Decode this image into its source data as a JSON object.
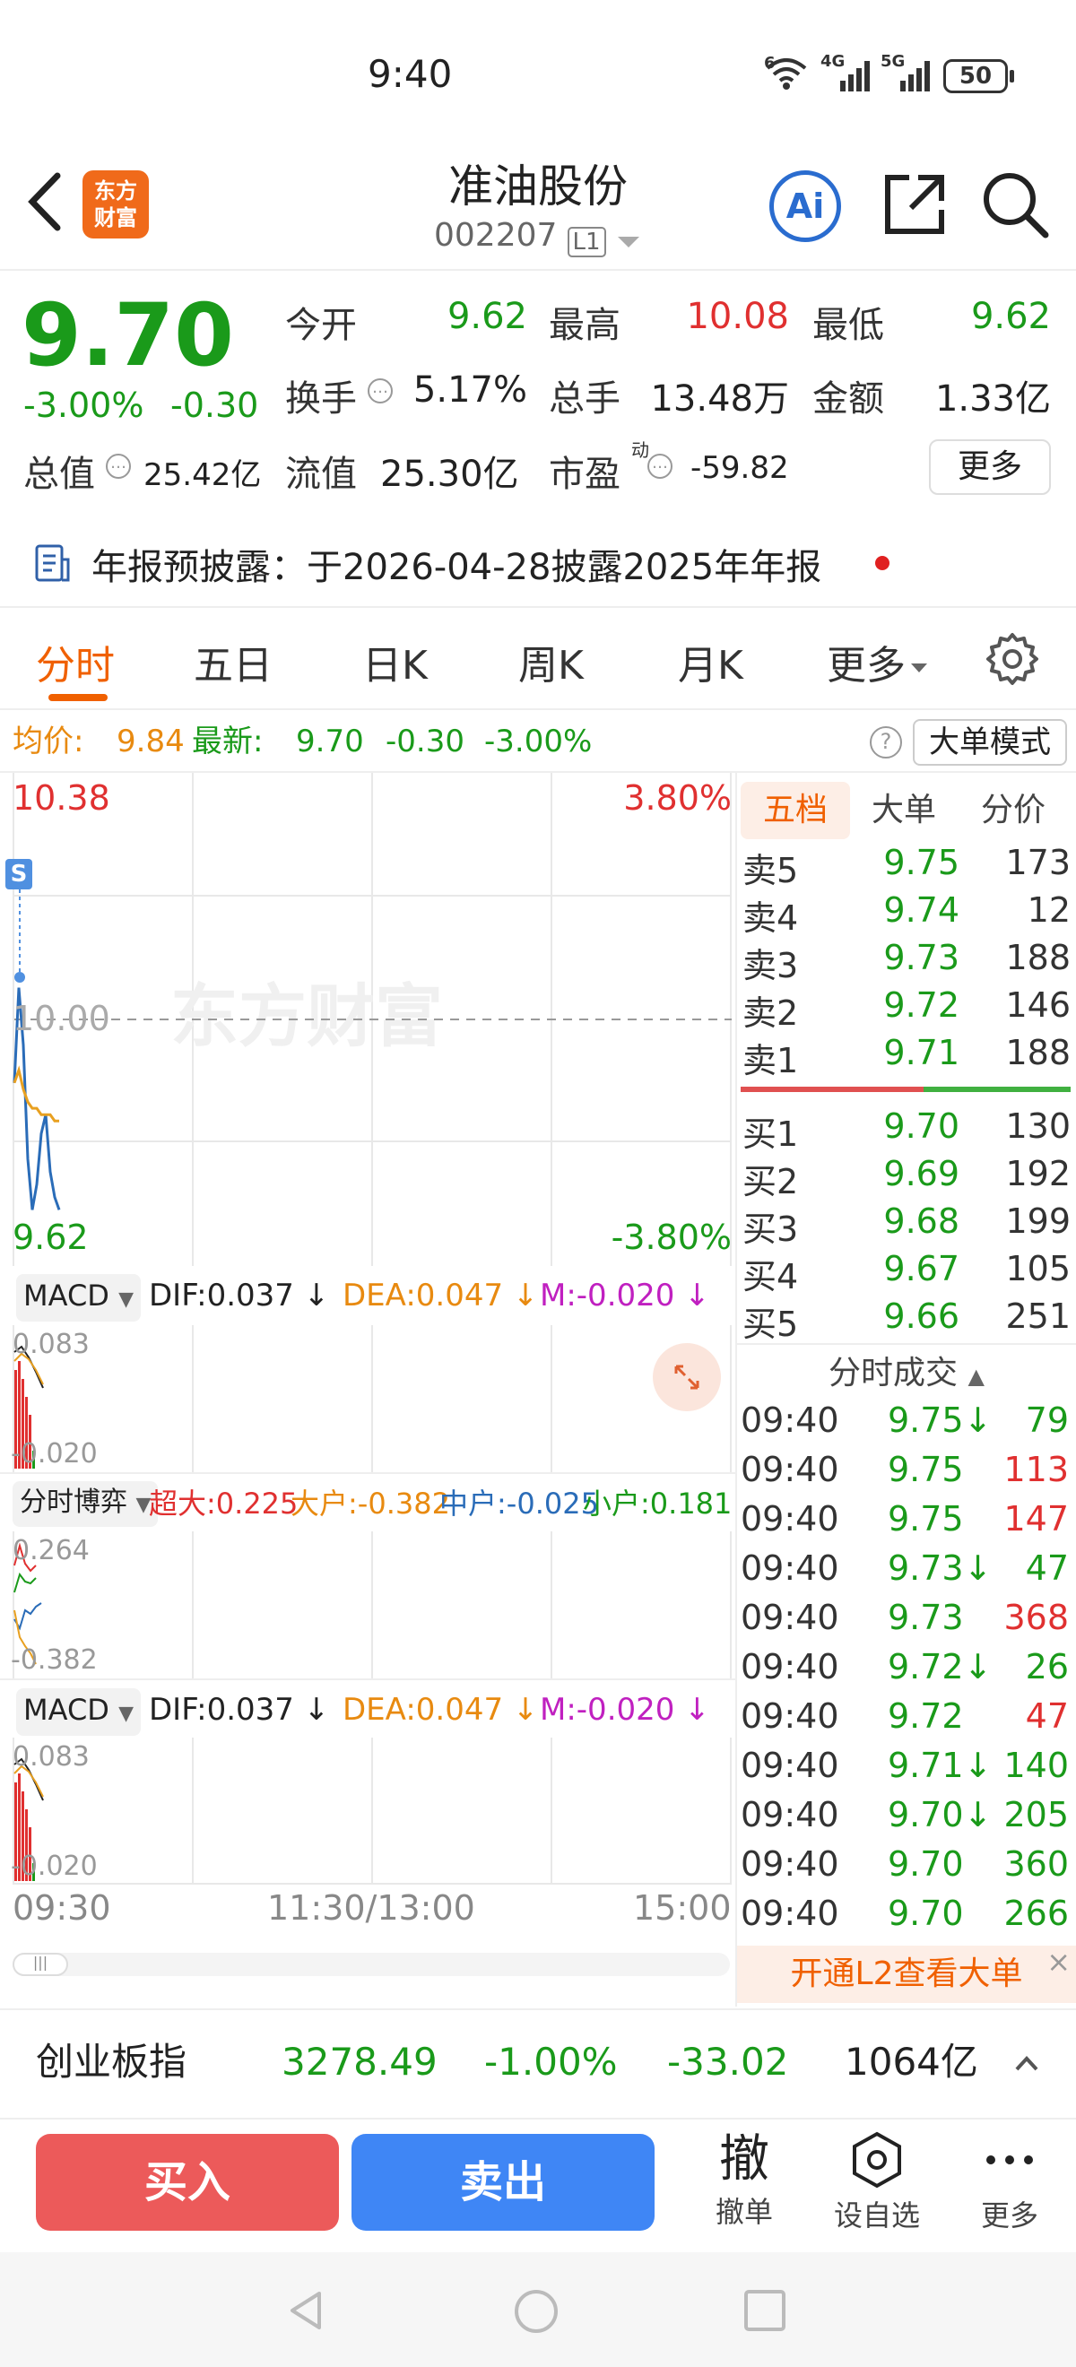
{
  "status_bar": {
    "time": "9:40",
    "net1": "6",
    "net2": "4G",
    "net3": "5G",
    "battery": "50"
  },
  "header": {
    "logo_text": "东方\n财富",
    "stock_name": "准油股份",
    "stock_code": "002207",
    "level": "L1",
    "ai_label": "Ai"
  },
  "quote": {
    "price": "9.70",
    "change_pct": "-3.00%",
    "change": "-0.30",
    "open_label": "今开",
    "open": "9.62",
    "high_label": "最高",
    "high": "10.08",
    "low_label": "最低",
    "low": "9.62",
    "turnover_label": "换手",
    "turnover": "5.17%",
    "volume_label": "总手",
    "volume": "13.48万",
    "amount_label": "金额",
    "amount": "1.33亿",
    "mktcap_label": "总值",
    "mktcap": "25.42亿",
    "float_label": "流值",
    "float": "25.30亿",
    "pe_label": "市盈",
    "pe_sup": "动",
    "pe": "-59.82",
    "more_label": "更多"
  },
  "notice": {
    "text": "年报预披露：于2026-04-28披露2025年年报"
  },
  "tabs": {
    "items": [
      "分时",
      "五日",
      "日K",
      "周K",
      "月K",
      "更多"
    ],
    "active": "分时"
  },
  "summary": {
    "avg_label": "均价:",
    "avg": "9.84",
    "latest_label": "最新:",
    "latest": "9.70",
    "chg": "-0.30",
    "chg_pct": "-3.00%",
    "mode_label": "大单模式"
  },
  "chart": {
    "y_top": "10.38",
    "y_top_pct": "3.80%",
    "y_mid": "10.00",
    "y_bot": "9.62",
    "y_bot_pct": "-3.80%",
    "watermark": "东方财富",
    "marker": "S",
    "x_left": "09:30",
    "x_mid": "11:30/13:00",
    "x_right": "15:00"
  },
  "chart_data": {
    "type": "line",
    "title": "",
    "xlabel": "",
    "ylabel": "",
    "x": [
      "09:30",
      "09:31",
      "09:32",
      "09:33",
      "09:34",
      "09:35",
      "09:36",
      "09:37",
      "09:38",
      "09:39",
      "09:40"
    ],
    "series": [
      {
        "name": "最新",
        "values": [
          9.9,
          10.05,
          9.96,
          9.78,
          9.7,
          9.74,
          9.82,
          9.85,
          9.76,
          9.72,
          9.7
        ]
      },
      {
        "name": "均价",
        "values": [
          9.9,
          9.92,
          9.89,
          9.87,
          9.86,
          9.86,
          9.85,
          9.85,
          9.85,
          9.84,
          9.84
        ]
      }
    ],
    "ylim": [
      9.62,
      10.38
    ],
    "grid": true
  },
  "macd1": {
    "sel": "MACD",
    "dif": "DIF:0.037",
    "dea": "DEA:0.047",
    "m": "M:-0.020",
    "top": "0.083",
    "bot": "-0.020"
  },
  "game": {
    "sel": "分时博弈",
    "super": "超大:0.225",
    "big": "大户:-0.382",
    "mid": "中户:-0.025",
    "small": "小户:0.181",
    "top": "0.264",
    "bot": "-0.382"
  },
  "macd2": {
    "sel": "MACD",
    "dif": "DIF:0.037",
    "dea": "DEA:0.047",
    "m": "M:-0.020",
    "top": "0.083",
    "bot": "-0.020"
  },
  "orderbook": {
    "tabs": [
      "五档",
      "大单",
      "分价"
    ],
    "asks": [
      {
        "label": "卖5",
        "price": "9.75",
        "vol": "173"
      },
      {
        "label": "卖4",
        "price": "9.74",
        "vol": "12"
      },
      {
        "label": "卖3",
        "price": "9.73",
        "vol": "188"
      },
      {
        "label": "卖2",
        "price": "9.72",
        "vol": "146"
      },
      {
        "label": "卖1",
        "price": "9.71",
        "vol": "188"
      }
    ],
    "bids": [
      {
        "label": "买1",
        "price": "9.70",
        "vol": "130"
      },
      {
        "label": "买2",
        "price": "9.69",
        "vol": "192"
      },
      {
        "label": "买3",
        "price": "9.68",
        "vol": "199"
      },
      {
        "label": "买4",
        "price": "9.67",
        "vol": "105"
      },
      {
        "label": "买5",
        "price": "9.66",
        "vol": "251"
      }
    ]
  },
  "trades": {
    "title": "分时成交",
    "rows": [
      {
        "time": "09:40",
        "price": "9.75↓",
        "vol": "79",
        "vol_color": "#1a9a1a"
      },
      {
        "time": "09:40",
        "price": "9.75",
        "vol": "113",
        "vol_color": "#e03030"
      },
      {
        "time": "09:40",
        "price": "9.75",
        "vol": "147",
        "vol_color": "#e03030"
      },
      {
        "time": "09:40",
        "price": "9.73↓",
        "vol": "47",
        "vol_color": "#1a9a1a"
      },
      {
        "time": "09:40",
        "price": "9.73",
        "vol": "368",
        "vol_color": "#e03030"
      },
      {
        "time": "09:40",
        "price": "9.72↓",
        "vol": "26",
        "vol_color": "#1a9a1a"
      },
      {
        "time": "09:40",
        "price": "9.72",
        "vol": "47",
        "vol_color": "#e03030"
      },
      {
        "time": "09:40",
        "price": "9.71↓",
        "vol": "140",
        "vol_color": "#1a9a1a"
      },
      {
        "time": "09:40",
        "price": "9.70↓",
        "vol": "205",
        "vol_color": "#1a9a1a"
      },
      {
        "time": "09:40",
        "price": "9.70",
        "vol": "360",
        "vol_color": "#1a9a1a"
      },
      {
        "time": "09:40",
        "price": "9.70",
        "vol": "266",
        "vol_color": "#1a9a1a"
      }
    ],
    "l2_label": "开通L2查看大单"
  },
  "index_bar": {
    "name": "创业板指",
    "value": "3278.49",
    "pct": "-1.00%",
    "chg": "-33.02",
    "amount": "1064亿"
  },
  "actions": {
    "buy": "买入",
    "sell": "卖出",
    "cancel_char": "撤",
    "cancel": "撤单",
    "watch": "设自选",
    "more": "更多"
  },
  "colors": {
    "up": "#e03030",
    "down": "#1a9a1a",
    "accent": "#f06000",
    "price_line": "#2a6cb8",
    "avg_line": "#e8a020"
  }
}
